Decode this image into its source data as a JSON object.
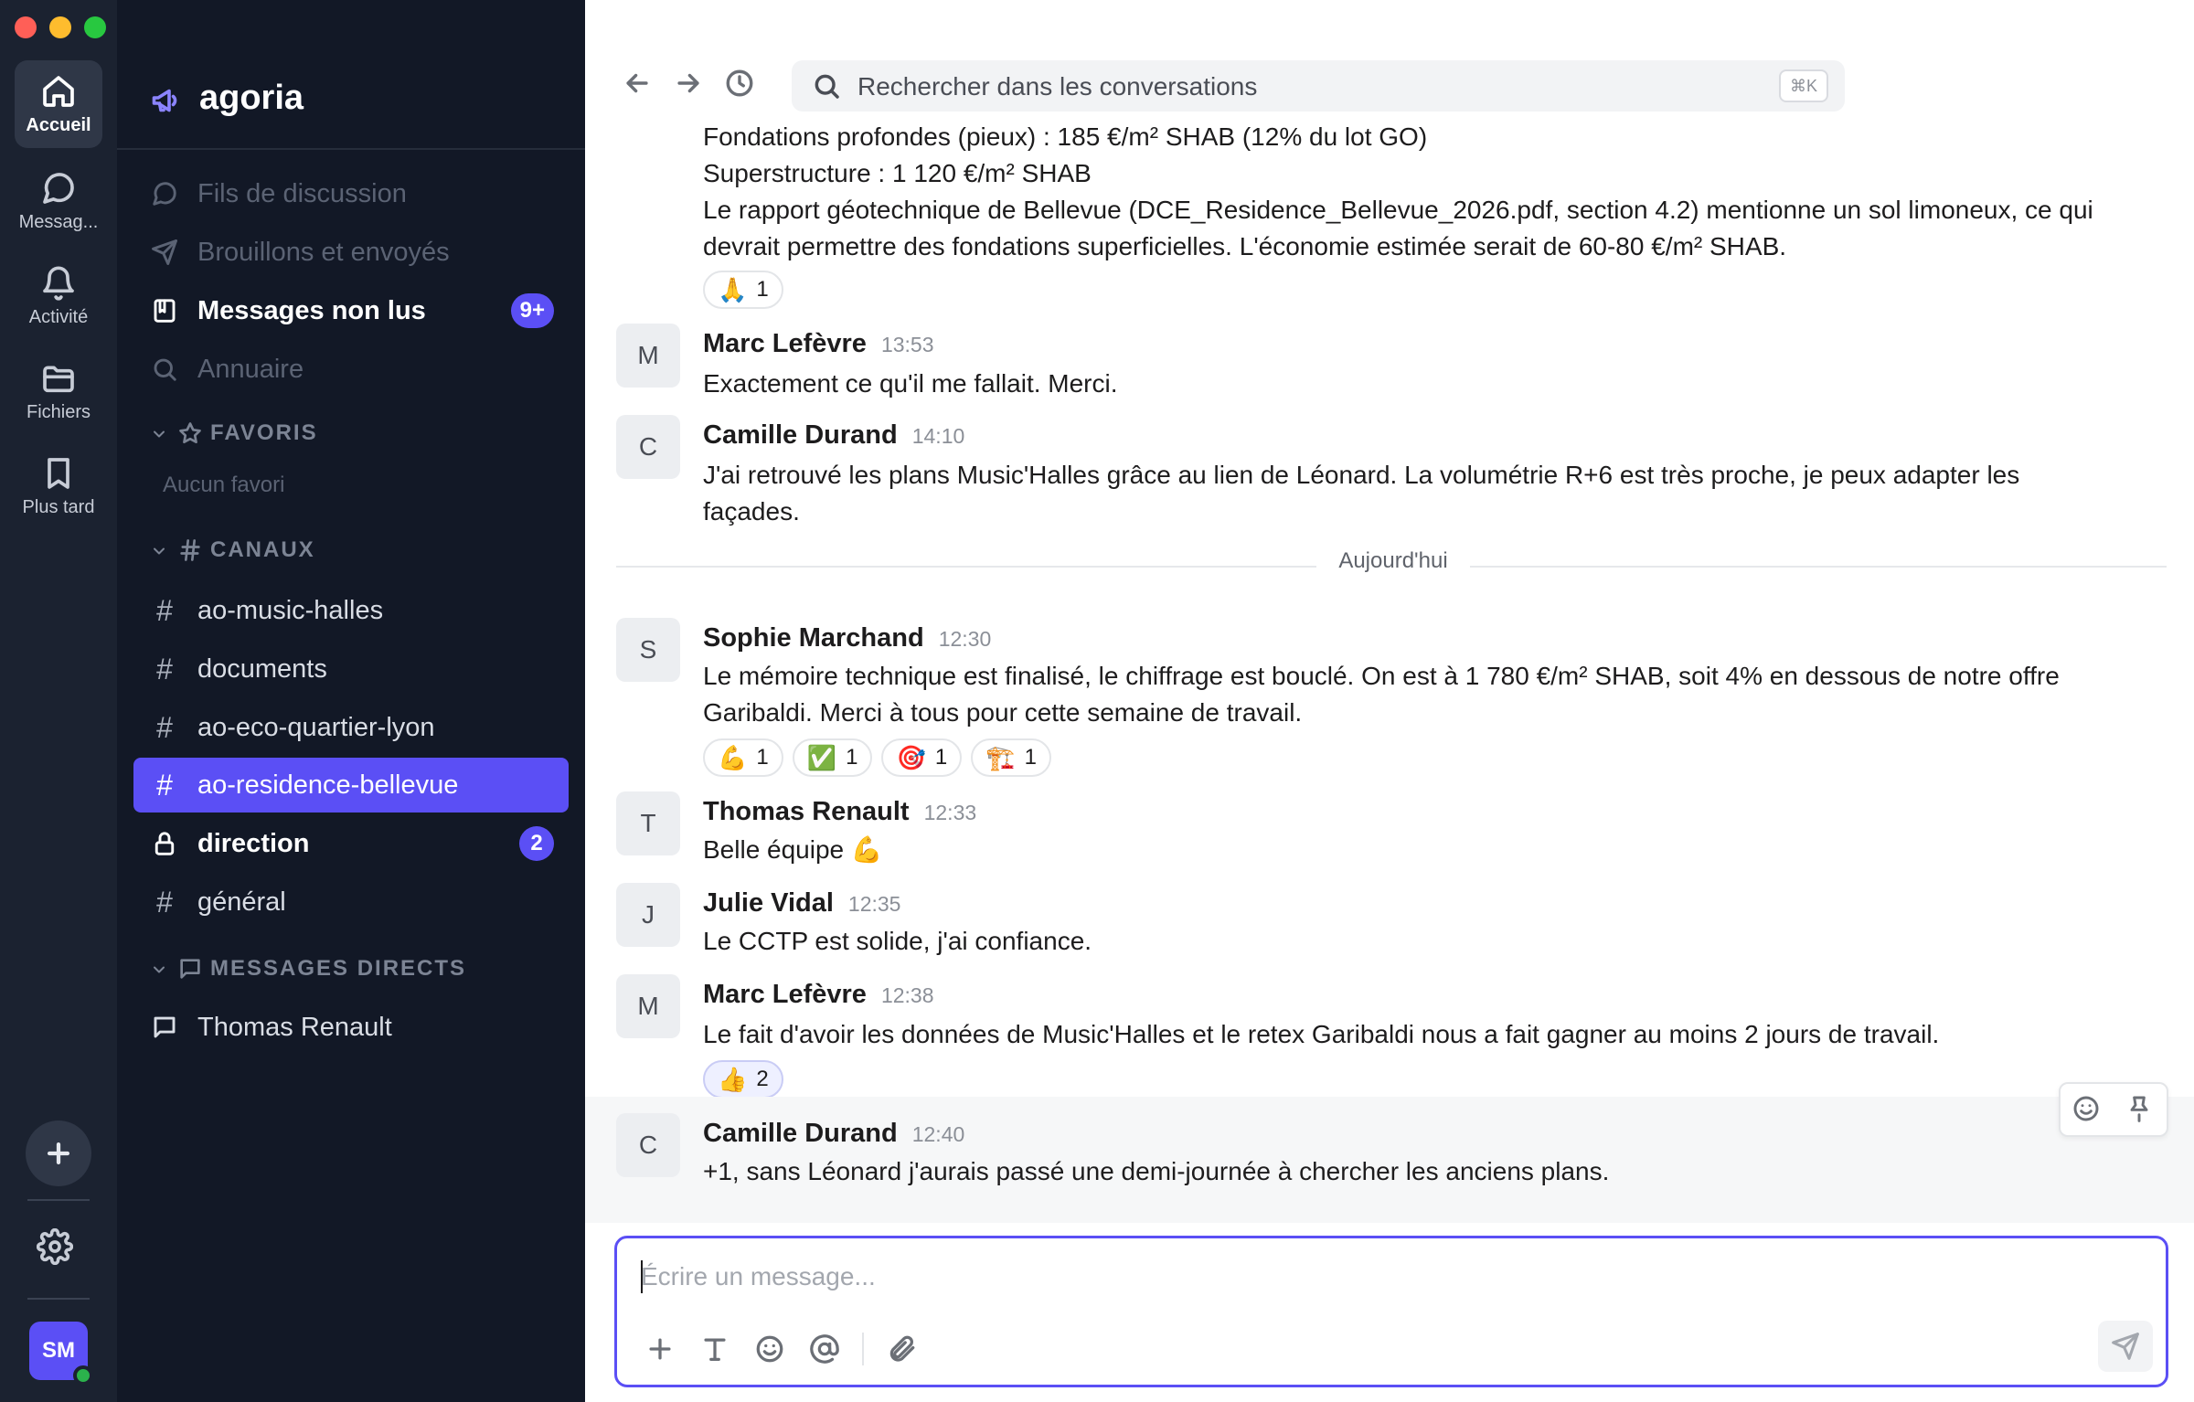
{
  "rail": {
    "items": [
      {
        "label": "Accueil",
        "icon": "home-icon"
      },
      {
        "label": "Messag...",
        "icon": "message-icon"
      },
      {
        "label": "Activité",
        "icon": "bell-icon"
      },
      {
        "label": "Fichiers",
        "icon": "folder-icon"
      },
      {
        "label": "Plus tard",
        "icon": "bookmark-icon"
      }
    ],
    "avatar_initials": "SM",
    "status_color": "#2bb24c"
  },
  "workspace": {
    "name": "agoria",
    "accent": "#5b4ff5"
  },
  "sidebar": {
    "nav": [
      {
        "label": "Fils de discussion"
      },
      {
        "label": "Brouillons et envoyés"
      },
      {
        "label": "Messages non lus",
        "badge": "9+"
      },
      {
        "label": "Annuaire"
      }
    ],
    "favorites_header": "FAVORIS",
    "favorites_empty": "Aucun favori",
    "channels_header": "CANAUX",
    "channels": [
      {
        "name": "ao-music-halles"
      },
      {
        "name": "documents"
      },
      {
        "name": "ao-eco-quartier-lyon"
      },
      {
        "name": "ao-residence-bellevue"
      },
      {
        "name": "direction",
        "badge": "2"
      },
      {
        "name": "général"
      }
    ],
    "dm_header": "MESSAGES DIRECTS",
    "dms": [
      {
        "name": "Thomas Renault"
      }
    ]
  },
  "topbar": {
    "search_placeholder": "Rechercher dans les conversations",
    "shortcut": "⌘K"
  },
  "messages": {
    "prev_lines": [
      "Fondations profondes (pieux) : 185 €/m² SHAB (12% du lot GO)",
      "Superstructure : 1 120 €/m² SHAB",
      "Le rapport géotechnique de Bellevue (DCE_Residence_Bellevue_2026.pdf, section 4.2) mentionne un sol limoneux, ce qui",
      "devrait permettre des fondations superficielles. L'économie estimée serait de 60-80 €/m² SHAB."
    ],
    "prev_reactions": [
      {
        "emoji": "🙏",
        "count": "1"
      }
    ],
    "day_divider": "Aujourd'hui",
    "list": [
      {
        "initial": "M",
        "author": "Marc Lefèvre",
        "time": "13:53",
        "lines": [
          "Exactement ce qu'il me fallait. Merci."
        ]
      },
      {
        "initial": "C",
        "author": "Camille Durand",
        "time": "14:10",
        "lines": [
          "J'ai retrouvé les plans Music'Halles grâce au lien de Léonard. La volumétrie R+6 est très proche, je peux adapter les",
          "façades."
        ]
      },
      {
        "initial": "S",
        "author": "Sophie Marchand",
        "time": "12:30",
        "lines": [
          "Le mémoire technique est finalisé, le chiffrage est bouclé. On est à 1 780 €/m² SHAB, soit 4% en dessous de notre offre",
          "Garibaldi. Merci à tous pour cette semaine de travail."
        ],
        "reactions": [
          {
            "emoji": "💪",
            "count": "1"
          },
          {
            "emoji": "✅",
            "count": "1"
          },
          {
            "emoji": "🎯",
            "count": "1"
          },
          {
            "emoji": "🏗️",
            "count": "1"
          }
        ]
      },
      {
        "initial": "T",
        "author": "Thomas Renault",
        "time": "12:33",
        "lines": [
          "Belle équipe 💪"
        ]
      },
      {
        "initial": "J",
        "author": "Julie Vidal",
        "time": "12:35",
        "lines": [
          "Le CCTP est solide, j'ai confiance."
        ]
      },
      {
        "initial": "M",
        "author": "Marc Lefèvre",
        "time": "12:38",
        "lines": [
          "Le fait d'avoir les données de Music'Halles et le retex Garibaldi nous a fait gagner au moins 2 jours de travail."
        ],
        "reactions": [
          {
            "emoji": "👍",
            "count": "2"
          }
        ]
      },
      {
        "initial": "C",
        "author": "Camille Durand",
        "time": "12:40",
        "lines": [
          "+1, sans Léonard j'aurais passé une demi-journée à chercher les anciens plans."
        ]
      }
    ]
  },
  "composer": {
    "placeholder": "Écrire un message..."
  }
}
